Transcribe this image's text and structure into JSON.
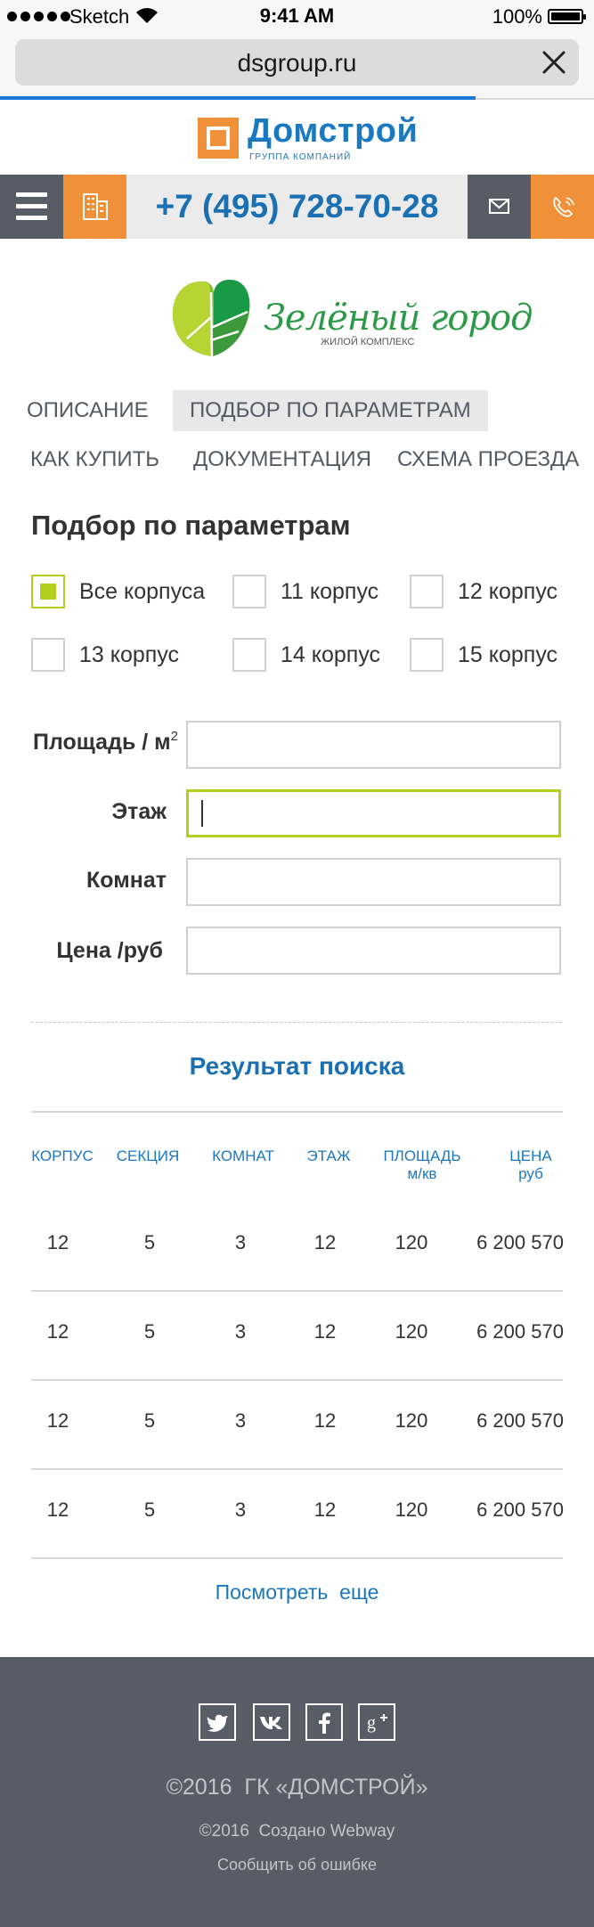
{
  "status_bar": {
    "carrier": "Sketch",
    "time": "9:41 AM",
    "battery": "100%",
    "battery_level": 1.0
  },
  "browser": {
    "url": "dsgroup.ru",
    "load_progress": 0.8
  },
  "header": {
    "logo_name": "Домстрой",
    "logo_subtitle": "ГРУППА КОМПАНИЙ",
    "phone": "+7 (495) 728-70-28"
  },
  "project": {
    "name": "Зелёный город",
    "subtitle": "ЖИЛОЙ КОМПЛЕКС"
  },
  "tabs": [
    {
      "label": "ОПИСАНИЕ",
      "active": false
    },
    {
      "label": "ПОДБОР ПО ПАРАМЕТРАМ",
      "active": true
    },
    {
      "label": "КАК КУПИТЬ",
      "active": false
    },
    {
      "label": "ДОКУМЕНТАЦИЯ",
      "active": false
    },
    {
      "label": "СХЕМА ПРОЕЗДА",
      "active": false
    }
  ],
  "filter": {
    "title": "Подбор по параметрам",
    "buildings": [
      {
        "label": "Все корпуса",
        "checked": true
      },
      {
        "label": "11 корпус",
        "checked": false
      },
      {
        "label": "12 корпус",
        "checked": false
      },
      {
        "label": "13 корпус",
        "checked": false
      },
      {
        "label": "14 корпус",
        "checked": false
      },
      {
        "label": "15 корпус",
        "checked": false
      }
    ],
    "fields": {
      "area": {
        "label": "Площадь / м",
        "sup": "2",
        "value": ""
      },
      "floor": {
        "label": "Этаж",
        "value": ""
      },
      "rooms": {
        "label": "Комнат",
        "value": ""
      },
      "price": {
        "label": "Цена /руб",
        "value": ""
      }
    }
  },
  "results": {
    "title": "Результат поиска",
    "headers": {
      "building": "КОРПУС",
      "section": "СЕКЦИЯ",
      "rooms": "КОМНАТ",
      "floor": "ЭТАЖ",
      "area": "ПЛОЩАДЬ",
      "area_unit": "м/кв",
      "price": "ЦЕНА",
      "price_unit": "руб"
    },
    "rows": [
      {
        "building": "12",
        "section": "5",
        "rooms": "3",
        "floor": "12",
        "area": "120",
        "price": "6 200 570"
      },
      {
        "building": "12",
        "section": "5",
        "rooms": "3",
        "floor": "12",
        "area": "120",
        "price": "6 200 570"
      },
      {
        "building": "12",
        "section": "5",
        "rooms": "3",
        "floor": "12",
        "area": "120",
        "price": "6 200 570"
      },
      {
        "building": "12",
        "section": "5",
        "rooms": "3",
        "floor": "12",
        "area": "120",
        "price": "6 200 570"
      }
    ],
    "more": "Посмотреть  еще"
  },
  "footer": {
    "social": [
      "twitter-icon",
      "vk-icon",
      "facebook-icon",
      "google-plus-icon"
    ],
    "copyright": "©2016  ГК «ДОМСТРОЙ»",
    "credit": "©2016  Создано Webway",
    "report": "Сообщить об ошибке"
  },
  "colors": {
    "accent_blue": "#1b6fb3",
    "accent_orange": "#f0913a",
    "accent_green": "#b3cf1d",
    "dark_gray": "#585c66"
  }
}
